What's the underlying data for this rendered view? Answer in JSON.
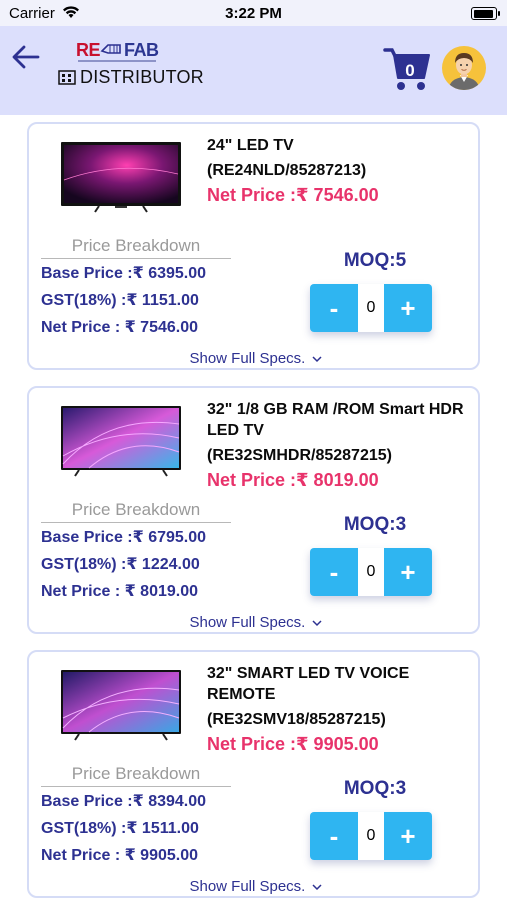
{
  "status": {
    "carrier": "Carrier",
    "time": "3:22 PM"
  },
  "header": {
    "logo_left": "RE",
    "logo_right": "FAB",
    "subtitle": "DISTRIBUTOR",
    "cart_count": "0"
  },
  "products": [
    {
      "name": "24\" LED TV",
      "code": "(RE24NLD/85287213)",
      "net_price_header": "Net Price :₹ 7546.00",
      "breakdown_title": "Price Breakdown",
      "base_price": "Base Price :₹ 6395.00",
      "gst": "GST(18%) :₹ 1151.00",
      "net_price": "Net Price : ₹ 7546.00",
      "moq": "MOQ:5",
      "minus": "-",
      "plus": "+",
      "qty": "0",
      "specs": "Show Full Specs."
    },
    {
      "name": "32\" 1/8 GB RAM /ROM Smart HDR LED TV",
      "code": "(RE32SMHDR/85287215)",
      "net_price_header": "Net Price :₹ 8019.00",
      "breakdown_title": "Price Breakdown",
      "base_price": "Base Price :₹ 6795.00",
      "gst": "GST(18%) :₹ 1224.00",
      "net_price": "Net Price : ₹ 8019.00",
      "moq": "MOQ:3",
      "minus": "-",
      "plus": "+",
      "qty": "0",
      "specs": "Show Full Specs."
    },
    {
      "name": "32\" SMART LED TV VOICE REMOTE",
      "code": "(RE32SMV18/85287215)",
      "net_price_header": "Net Price :₹ 9905.00",
      "breakdown_title": "Price Breakdown",
      "base_price": "Base Price :₹ 8394.00",
      "gst": "GST(18%) :₹ 1511.00",
      "net_price": "Net Price : ₹ 9905.00",
      "moq": "MOQ:3",
      "minus": "-",
      "plus": "+",
      "qty": "0",
      "specs": "Show Full Specs."
    }
  ],
  "icons": {
    "back": "arrow-left-icon",
    "cart": "shopping-cart-icon",
    "avatar": "user-avatar",
    "chevron": "chevron-down-icon"
  },
  "colors": {
    "header_bg": "#dcdffc",
    "brand_navy": "#2d3191",
    "price_red": "#e8336b",
    "stepper_blue": "#2fb5f1",
    "card_border": "#d5dcf6"
  }
}
